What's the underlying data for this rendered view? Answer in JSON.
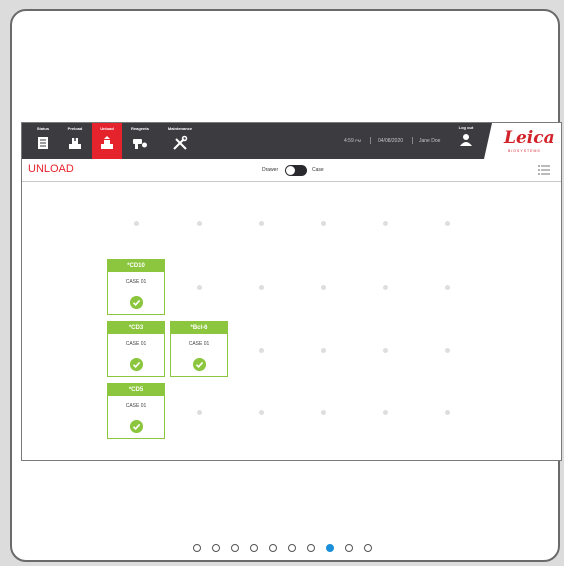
{
  "nav": {
    "tabs": [
      {
        "label": "Status",
        "icon": "status-icon"
      },
      {
        "label": "Preload",
        "icon": "preload-icon"
      },
      {
        "label": "Unload",
        "icon": "unload-icon",
        "active": true
      },
      {
        "label": "Reagents",
        "icon": "reagents-icon"
      },
      {
        "label": "Maintenance",
        "icon": "maintenance-icon"
      }
    ],
    "time": "4:59",
    "ampm": "PM",
    "date": "04/08/2020",
    "user": "Jane Doe",
    "logout_label": "Log out",
    "brand": "Leica",
    "brand_sub": "BIOSYSTEMS"
  },
  "subbar": {
    "title": "UNLOAD",
    "toggle_left": "Drawer",
    "toggle_right": "Case"
  },
  "slots": [
    {
      "header": "*CD10",
      "case": "CASE 01"
    },
    {
      "header": "*CD3",
      "case": "CASE 01"
    },
    {
      "header": "*Bcl-6",
      "case": "CASE 01"
    },
    {
      "header": "*CD5",
      "case": "CASE 01"
    }
  ],
  "pager": {
    "count": 10,
    "active_index": 7
  },
  "colors": {
    "accent": "#e5232d",
    "success": "#8cc63f",
    "pager_active": "#1a8fd9",
    "topbar": "#3b3b40"
  }
}
